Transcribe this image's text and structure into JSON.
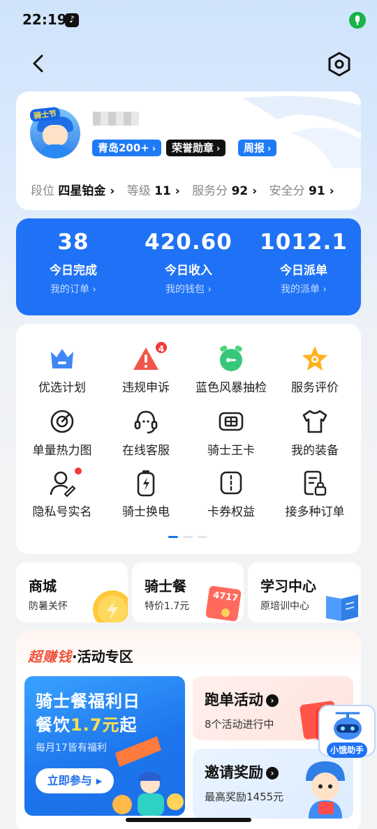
{
  "status_bar": {
    "time": "22:19"
  },
  "profile": {
    "tags": [
      {
        "label": "青岛200+",
        "style": "blue"
      },
      {
        "label": "荣誉勋章",
        "style": "black"
      },
      {
        "label": "周报",
        "style": "blue"
      }
    ],
    "stats": [
      {
        "label": "段位",
        "value": "四星铂金"
      },
      {
        "label": "等级",
        "value": "11"
      },
      {
        "label": "服务分",
        "value": "92"
      },
      {
        "label": "安全分",
        "value": "91"
      }
    ]
  },
  "summary": [
    {
      "value": "38",
      "label": "今日完成",
      "link": "我的订单"
    },
    {
      "value": "420.60",
      "label": "今日收入",
      "link": "我的钱包"
    },
    {
      "value": "1012.1",
      "label": "今日派单",
      "link": "我的派单"
    }
  ],
  "grid": [
    {
      "label": "优选计划",
      "icon": "crown-icon"
    },
    {
      "label": "违规申诉",
      "icon": "warning-icon",
      "badge": "4"
    },
    {
      "label": "蓝色风暴抽检",
      "icon": "alarm-clock-icon"
    },
    {
      "label": "服务评价",
      "icon": "star-icon"
    },
    {
      "label": "单量热力图",
      "icon": "target-icon"
    },
    {
      "label": "在线客服",
      "icon": "headset-icon"
    },
    {
      "label": "骑士王卡",
      "icon": "card-icon"
    },
    {
      "label": "我的装备",
      "icon": "shirt-icon"
    },
    {
      "label": "隐私号实名",
      "icon": "user-edit-icon",
      "dot": true
    },
    {
      "label": "骑士换电",
      "icon": "battery-icon"
    },
    {
      "label": "卡券权益",
      "icon": "coupon-icon"
    },
    {
      "label": "接多种订单",
      "icon": "order-lock-icon"
    }
  ],
  "mini_cards": [
    {
      "title": "商城",
      "sub": "防暑关怀"
    },
    {
      "title": "骑士餐",
      "sub": "特价1.7元",
      "art_text": "4717"
    },
    {
      "title": "学习中心",
      "sub": "原培训中心"
    }
  ],
  "activity": {
    "head_hot": "超赚钱",
    "head_rest": "·活动专区",
    "promo": {
      "line1": "骑士餐福利日",
      "line2_prefix": "餐饮",
      "line2_highlight": "1.7元",
      "line2_suffix": "起",
      "sub": "每月17皆有福利",
      "button": "立即参与"
    },
    "side": [
      {
        "title": "跑单活动",
        "sub": "8个活动进行中"
      },
      {
        "title": "邀请奖励",
        "sub": "最高奖励1455元"
      }
    ]
  },
  "helper": {
    "label": "小饿助手"
  },
  "colors": {
    "primary": "#1f72f5",
    "hot": "#f0533a",
    "badge": "#f23a3a"
  }
}
